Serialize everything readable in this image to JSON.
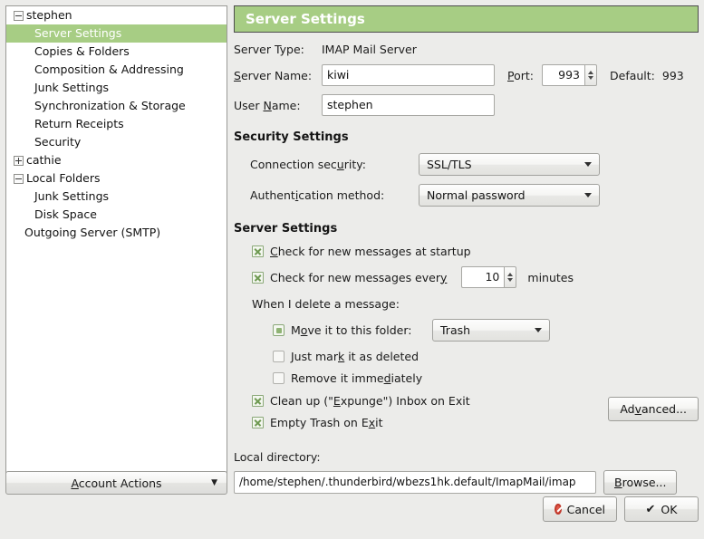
{
  "sidebar": {
    "items": [
      {
        "label": "stephen",
        "twisty": "minus",
        "indent": 0,
        "selected": false
      },
      {
        "label": "Server Settings",
        "twisty": "none",
        "indent": 1,
        "selected": true
      },
      {
        "label": "Copies & Folders",
        "twisty": "none",
        "indent": 1,
        "selected": false
      },
      {
        "label": "Composition & Addressing",
        "twisty": "none",
        "indent": 1,
        "selected": false
      },
      {
        "label": "Junk Settings",
        "twisty": "none",
        "indent": 1,
        "selected": false
      },
      {
        "label": "Synchronization & Storage",
        "twisty": "none",
        "indent": 1,
        "selected": false
      },
      {
        "label": "Return Receipts",
        "twisty": "none",
        "indent": 1,
        "selected": false
      },
      {
        "label": "Security",
        "twisty": "none",
        "indent": 1,
        "selected": false
      },
      {
        "label": "cathie",
        "twisty": "plus",
        "indent": 0,
        "selected": false
      },
      {
        "label": "Local Folders",
        "twisty": "minus",
        "indent": 0,
        "selected": false
      },
      {
        "label": "Junk Settings",
        "twisty": "none",
        "indent": 1,
        "selected": false
      },
      {
        "label": "Disk Space",
        "twisty": "none",
        "indent": 1,
        "selected": false
      },
      {
        "label": "Outgoing Server (SMTP)",
        "twisty": "none",
        "indent": "smtp",
        "selected": false
      }
    ],
    "account_actions": {
      "label": "Account Actions",
      "accel": "A",
      "arrow_icon": "chevron-down-icon"
    }
  },
  "pane": {
    "header_title": "Server Settings",
    "header_color": "#a7cd84",
    "server_type": {
      "label": "Server Type:",
      "value": "IMAP Mail Server"
    },
    "server_name": {
      "label_pre": "S",
      "label_post": "erver Name:",
      "value": "kiwi"
    },
    "port": {
      "label_pre": "P",
      "label_post": "ort:",
      "value": "993",
      "default_label": "Default:",
      "default_value": "993"
    },
    "user_name": {
      "label_pre": "User ",
      "label_accel": "N",
      "label_post": "ame:",
      "value": "stephen"
    },
    "security_section": {
      "title": "Security Settings",
      "connection_security": {
        "label_pre": "Connection sec",
        "label_accel": "u",
        "label_post": "rity:",
        "value": "SSL/TLS"
      },
      "authentication_method": {
        "label_pre": "Authent",
        "label_accel": "i",
        "label_post": "cation method:",
        "value": "Normal password"
      }
    },
    "server_section": {
      "title": "Server Settings",
      "check_startup": {
        "checked": true,
        "label_pre": "",
        "label_accel": "C",
        "label_post": "heck for new messages at startup"
      },
      "check_every": {
        "checked": true,
        "label_pre": "Check for new messages ever",
        "label_accel": "y",
        "label_post": "",
        "value": "10",
        "unit": "minutes"
      },
      "delete_label": "When I delete a message:",
      "move_to_folder": {
        "selected": true,
        "label_pre": "M",
        "label_accel": "o",
        "label_post": "ve it to this folder:",
        "folder": "Trash"
      },
      "just_mark": {
        "selected": false,
        "label_pre": "Just mar",
        "label_accel": "k",
        "label_post": " it as deleted"
      },
      "remove_immediately": {
        "selected": false,
        "label_pre": "Remove it imme",
        "label_accel": "d",
        "label_post": "iately"
      },
      "clean_up": {
        "checked": true,
        "label_pre": "Clean up (\"",
        "label_accel": "E",
        "label_post": "xpunge\") Inbox on Exit"
      },
      "empty_trash": {
        "checked": true,
        "label_pre": "Empty Trash on E",
        "label_accel": "x",
        "label_post": "it"
      },
      "advanced_button": {
        "label_pre": "Ad",
        "label_accel": "v",
        "label_post": "anced..."
      }
    },
    "local_directory": {
      "label": "Local directory:",
      "value": "/home/stephen/.thunderbird/wbezs1hk.default/ImapMail/imap",
      "browse_button": {
        "label_pre": "",
        "label_accel": "B",
        "label_post": "rowse..."
      }
    }
  },
  "footer": {
    "cancel": {
      "label": "Cancel",
      "icon": "deny-icon"
    },
    "ok": {
      "label": "OK",
      "icon": "check-icon"
    }
  }
}
